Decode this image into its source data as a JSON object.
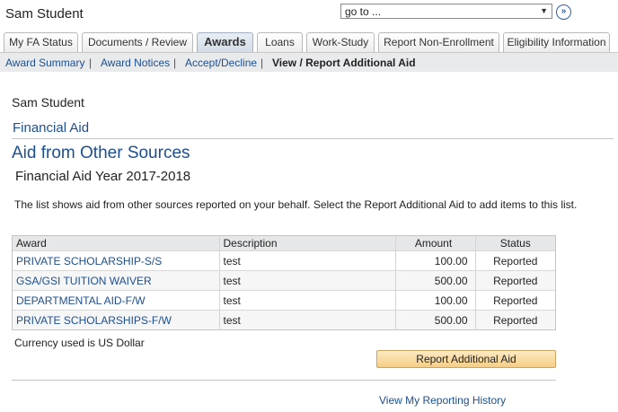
{
  "header": {
    "student_name": "Sam Student",
    "goto_placeholder": "go to ...",
    "goto_arrow": "▼",
    "go_button": "»"
  },
  "tabs": [
    {
      "label": "My FA Status"
    },
    {
      "label": "Documents / Review"
    },
    {
      "label": "Awards",
      "active": true
    },
    {
      "label": "Loans"
    },
    {
      "label": "Work-Study"
    },
    {
      "label": "Report Non-Enrollment"
    },
    {
      "label": "Eligibility Information"
    }
  ],
  "subnav": {
    "items": [
      {
        "label": "Award Summary"
      },
      {
        "label": "Award Notices"
      },
      {
        "label": "Accept/Decline"
      },
      {
        "label": "View / Report Additional Aid",
        "current": true
      }
    ],
    "separator": "|"
  },
  "main": {
    "student_name": "Sam Student",
    "section_heading": "Financial Aid",
    "page_title": "Aid from Other Sources",
    "aid_year": "Financial Aid Year 2017-2018",
    "instructions": "The list shows aid from other sources reported on your behalf.  Select the Report Additional Aid to add items to this list.",
    "table": {
      "columns": [
        "Award",
        "Description",
        "Amount",
        "Status"
      ],
      "rows": [
        {
          "award": "PRIVATE SCHOLARSHIP-S/S",
          "description": "test",
          "amount": "100.00",
          "status": "Reported"
        },
        {
          "award": "GSA/GSI TUITION WAIVER",
          "description": "test",
          "amount": "500.00",
          "status": "Reported"
        },
        {
          "award": "DEPARTMENTAL AID-F/W",
          "description": "test",
          "amount": "100.00",
          "status": "Reported"
        },
        {
          "award": "PRIVATE SCHOLARSHIPS-F/W",
          "description": "test",
          "amount": "500.00",
          "status": "Reported"
        }
      ]
    },
    "currency_note": "Currency used is US Dollar",
    "report_button": "Report Additional Aid",
    "history_link": "View My Reporting History"
  },
  "colors": {
    "link": "#1d4f91",
    "button_bg": "#f6cf86",
    "subnav_bg": "#e9eaec"
  }
}
